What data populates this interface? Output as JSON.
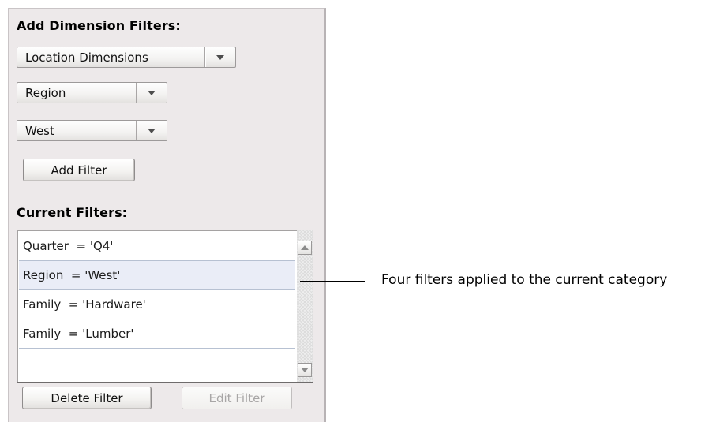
{
  "add_filters": {
    "title": "Add Dimension Filters:",
    "dimension_group_select": "Location Dimensions",
    "dimension_select": "Region",
    "value_select": "West",
    "add_button": "Add Filter"
  },
  "current_filters": {
    "title": "Current Filters:",
    "items": [
      "Quarter  = 'Q4'",
      "Region  = 'West'",
      "Family  = 'Hardware'",
      "Family  = 'Lumber'"
    ],
    "selected_index": 1,
    "delete_button": "Delete Filter",
    "edit_button": "Edit Filter"
  },
  "callout": {
    "text": "Four filters applied to the current category"
  },
  "icons": {
    "dropdown": "chevron-down-icon",
    "scroll_up": "scroll-up-arrow-icon",
    "scroll_down": "scroll-down-arrow-icon"
  },
  "colors": {
    "panel_bg": "#ede9ea",
    "selected_row": "#eaedf7",
    "row_divider": "#b7c1d2",
    "disabled_text": "#a8a6a6"
  }
}
